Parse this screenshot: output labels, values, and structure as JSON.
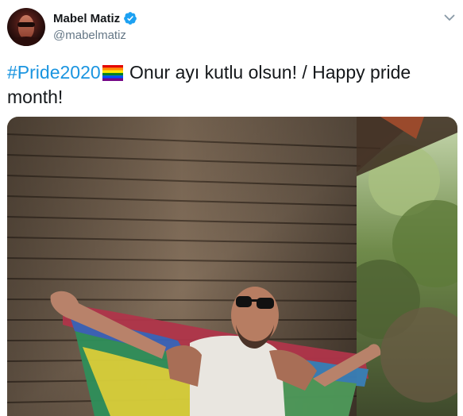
{
  "author": {
    "display_name": "Mabel Matiz",
    "handle": "@mabelmatiz",
    "verified": true
  },
  "tweet": {
    "hashtag": "#Pride2020",
    "text_after_flag": " Onur ayı kutlu olsun! / Happy pride month!",
    "emoji": "rainbow-flag-icon"
  },
  "media": {
    "type": "photo",
    "alt": ""
  },
  "colors": {
    "link": "#1b95e0",
    "verified": "#1da1f2",
    "secondary_text": "#657786",
    "primary_text": "#14171a"
  },
  "icons": [
    "verified-badge-icon",
    "chevron-down-icon",
    "rainbow-flag-icon"
  ]
}
